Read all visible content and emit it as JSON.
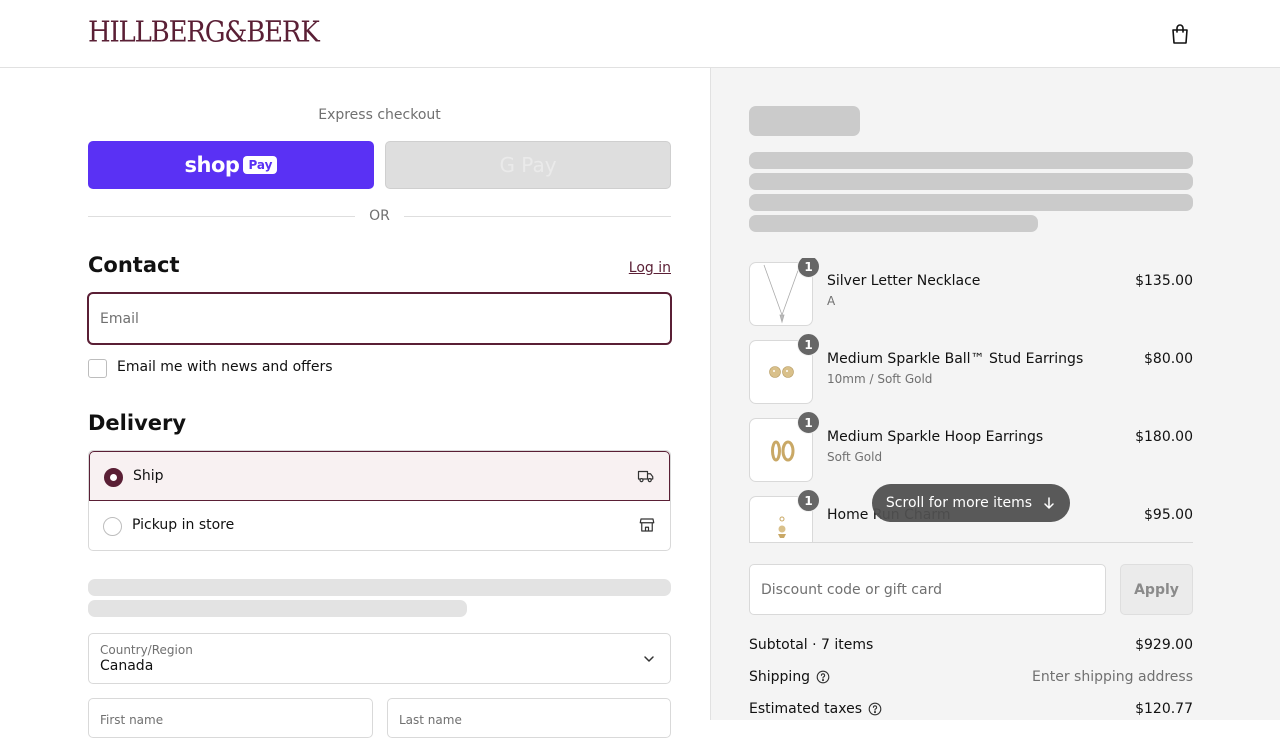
{
  "header": {
    "logo": "HILLBERG&BERK",
    "cart_icon": "shopping-bag-icon"
  },
  "express": {
    "title": "Express checkout",
    "shop_pay_word": "shop",
    "shop_pay_badge": "Pay",
    "gpay_label": "G Pay",
    "or": "OR"
  },
  "contact": {
    "title": "Contact",
    "login": "Log in",
    "email_placeholder": "Email",
    "email_value": "",
    "newsletter_label": "Email me with news and offers",
    "newsletter_checked": false
  },
  "delivery": {
    "title": "Delivery",
    "options": [
      {
        "label": "Ship",
        "selected": true,
        "icon": "truck-icon"
      },
      {
        "label": "Pickup in store",
        "selected": false,
        "icon": "store-icon"
      }
    ],
    "country_label": "Country/Region",
    "country_value": "Canada",
    "first_name_label": "First name",
    "last_name_label": "Last name"
  },
  "order": {
    "items": [
      {
        "name": "Silver Letter Necklace",
        "variant": "A",
        "price": "$135.00",
        "qty": "1"
      },
      {
        "name": "Medium Sparkle Ball™ Stud Earrings",
        "variant": "10mm / Soft Gold",
        "price": "$80.00",
        "qty": "1"
      },
      {
        "name": "Medium Sparkle Hoop Earrings",
        "variant": "Soft Gold",
        "price": "$180.00",
        "qty": "1"
      },
      {
        "name": "Home Run Charm",
        "variant": "",
        "price": "$95.00",
        "qty": "1"
      }
    ],
    "scroll_hint": "Scroll for more items",
    "discount_placeholder": "Discount code or gift card",
    "apply": "Apply",
    "subtotal_label": "Subtotal · 7 items",
    "subtotal_value": "$929.00",
    "shipping_label": "Shipping",
    "shipping_value": "Enter shipping address",
    "taxes_label": "Estimated taxes",
    "taxes_value": "$120.77"
  },
  "colors": {
    "brand": "#5a1f35",
    "shop_pay": "#5a31f4",
    "panel": "#f4f4f4"
  }
}
